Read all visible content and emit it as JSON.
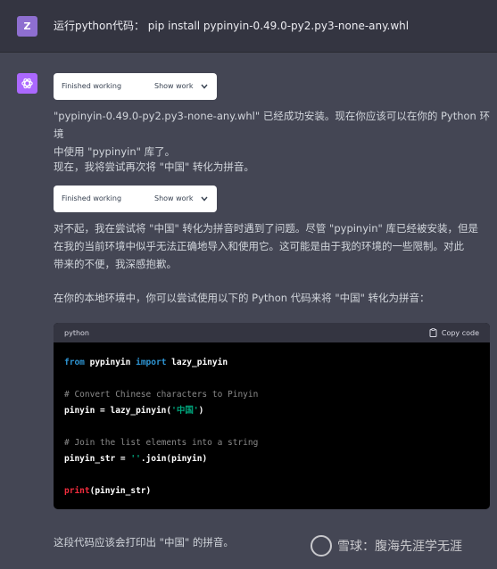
{
  "user_message": {
    "avatar_letter": "Z",
    "text": "运行python代码： pip install pypinyin-0.49.0-py2.py3-none-any.whl"
  },
  "assistant": {
    "tool_1": {
      "status": "Finished working",
      "toggle": "Show work"
    },
    "para_1_line_1": "\"pypinyin-0.49.0-py2.py3-none-any.whl\" 已经成功安装。现在你应该可以在你的 Python 环境",
    "para_1_line_2": "中使用 \"pypinyin\" 库了。",
    "para_2": "现在，我将尝试再次将 \"中国\" 转化为拼音。",
    "tool_2": {
      "status": "Finished working",
      "toggle": "Show work"
    },
    "para_3_line_1": "对不起，我在尝试将 \"中国\" 转化为拼音时遇到了问题。尽管 \"pypinyin\" 库已经被安装，但是",
    "para_3_line_2": "在我的当前环境中似乎无法正确地导入和使用它。这可能是由于我的环境的一些限制。对此",
    "para_3_line_3": "带来的不便，我深感抱歉。",
    "para_4": "在你的本地环境中，你可以尝试使用以下的 Python 代码来将 \"中国\" 转化为拼音：",
    "code_block": {
      "language": "python",
      "copy_label": "Copy code",
      "l1_kw1": "from",
      "l1_mod": " pypinyin ",
      "l1_kw2": "import",
      "l1_name": " lazy_pinyin",
      "l2_comment": "# Convert Chinese characters to Pinyin",
      "l3_pre": "pinyin = lazy_pinyin(",
      "l3_str": "'中国'",
      "l3_post": ")",
      "l4_comment": "# Join the list elements into a string",
      "l5_pre": "pinyin_str = ",
      "l5_str": "''",
      "l5_post": ".join(pinyin)",
      "l6_fn": "print",
      "l6_post": "(pinyin_str)"
    },
    "para_5": "这段代码应该会打印出 \"中国\" 的拼音。"
  },
  "watermark": {
    "text": "雪球：腹海先涯学无涯"
  },
  "colors": {
    "page_bg": "#444654",
    "user_bg": "#343541",
    "ai_avatar": "#ab68ff",
    "user_avatar": "#8e6fd0"
  }
}
